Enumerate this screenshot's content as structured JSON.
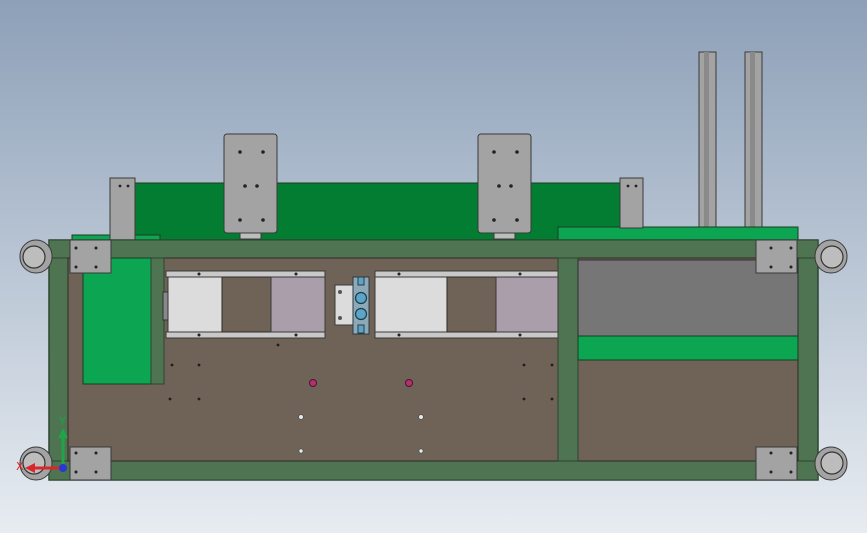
{
  "viewport": {
    "background_top": "#8da0b8",
    "background_bottom": "#e7ecf1"
  },
  "colors": {
    "frame_green": "#4e7451",
    "frame_edge": "#2d4430",
    "plate_brown": "#6f6257",
    "bright_green": "#0ca652",
    "dark_green": "#037d31",
    "metal_gray": "#a3a3a3",
    "light_gray": "#dcdcdc",
    "mauve": "#a99ea9",
    "panel_gray": "#767676",
    "blue_part": "#5aa6c9",
    "magenta_hole": "#b4306e"
  },
  "triad": {
    "x_label": "X",
    "y_label": "Y",
    "x_color": "#d9262b",
    "y_color": "#21a34a",
    "z_color": "#2a37d1"
  }
}
